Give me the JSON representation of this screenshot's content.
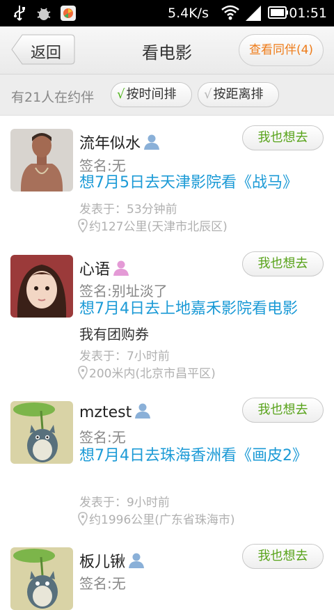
{
  "status_bar": {
    "speed": "5.4K/s",
    "time": "01:51",
    "icons": [
      "usb-icon",
      "debug-icon",
      "app-icon",
      "wifi-icon",
      "signal-icon",
      "battery-icon"
    ]
  },
  "header": {
    "back_label": "返回",
    "title": "看电影",
    "companion_label": "查看同伴(4)"
  },
  "filter_bar": {
    "count_text": "有21人在约伴",
    "sort_time_label": "按时间排",
    "sort_distance_label": "按距离排",
    "check_glyph": "√",
    "active_sort": "time"
  },
  "colors": {
    "link_blue": "#1b9ad6",
    "orange": "#ee7b18",
    "green": "#58a31a",
    "male": "#8ab0d8",
    "female": "#e49ad6"
  },
  "posts": [
    {
      "name": "流年似水",
      "gender": "male",
      "button_label": "我也想去",
      "signature": "签名:无",
      "plan": "想7月5日去天津影院看《战马》",
      "extra": "",
      "posted": "发表于：53分钟前",
      "location": "约127公里(天津市北辰区)"
    },
    {
      "name": "心语",
      "gender": "female",
      "button_label": "我也想去",
      "signature": "签名:别址淡了",
      "plan": "想7月4日去上地嘉禾影院看电影",
      "extra": "我有团购券",
      "posted": "发表于：7小时前",
      "location": "200米内(北京市昌平区)"
    },
    {
      "name": "mztest",
      "gender": "male",
      "button_label": "我也想去",
      "signature": "签名:无",
      "plan": "想7月4日去珠海香洲看《画皮2》",
      "extra": "",
      "posted": "发表于：9小时前",
      "location": "约1996公里(广东省珠海市)"
    },
    {
      "name": "板儿锹",
      "gender": "male",
      "button_label": "我也想去",
      "signature": "签名:无",
      "plan": "",
      "extra": "",
      "posted": "",
      "location": ""
    }
  ]
}
